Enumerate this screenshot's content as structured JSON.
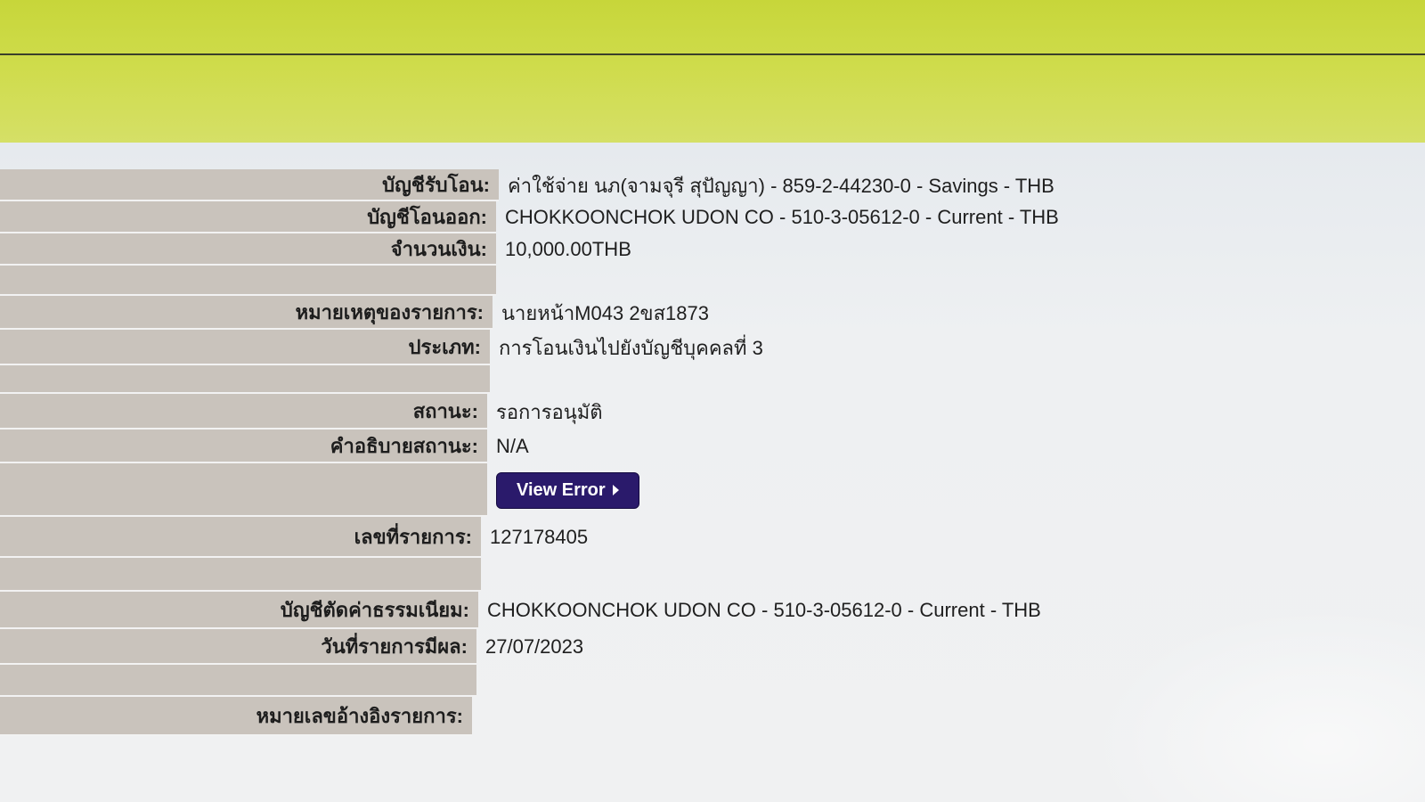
{
  "rows": {
    "receiving_account": {
      "label": "บัญชีรับโอน:",
      "value": "ค่าใช้จ่าย นภ(จามจุรี สุปัญญา) - 859-2-44230-0 - Savings - THB"
    },
    "sending_account": {
      "label": "บัญชีโอนออก:",
      "value": "CHOKKOONCHOK UDON CO - 510-3-05612-0 - Current - THB"
    },
    "amount": {
      "label": "จำนวนเงิน:",
      "value": "10,000.00THB"
    },
    "note": {
      "label": "หมายเหตุของรายการ:",
      "value": "นายหน้าM043 2ขส1873"
    },
    "type": {
      "label": "ประเภท:",
      "value": "การโอนเงินไปยังบัญชีบุคคลที่ 3"
    },
    "status": {
      "label": "สถานะ:",
      "value": "รอการอนุมัติ"
    },
    "status_description": {
      "label": "คำอธิบายสถานะ:",
      "value": "N/A"
    },
    "view_error": {
      "button_label": "View Error"
    },
    "transaction_number": {
      "label": "เลขที่รายการ:",
      "value": "127178405"
    },
    "fee_account": {
      "label": "บัญชีตัดค่าธรรมเนียม:",
      "value": "CHOKKOONCHOK UDON CO - 510-3-05612-0 - Current - THB"
    },
    "effective_date": {
      "label": "วันที่รายการมีผล:",
      "value": "27/07/2023"
    },
    "reference_number": {
      "label": "หมายเลขอ้างอิงรายการ:",
      "value": ""
    }
  },
  "colors": {
    "header_band": "#c7d63a",
    "label_background": "#c9c3bc",
    "button_background": "#2a1a6b"
  }
}
